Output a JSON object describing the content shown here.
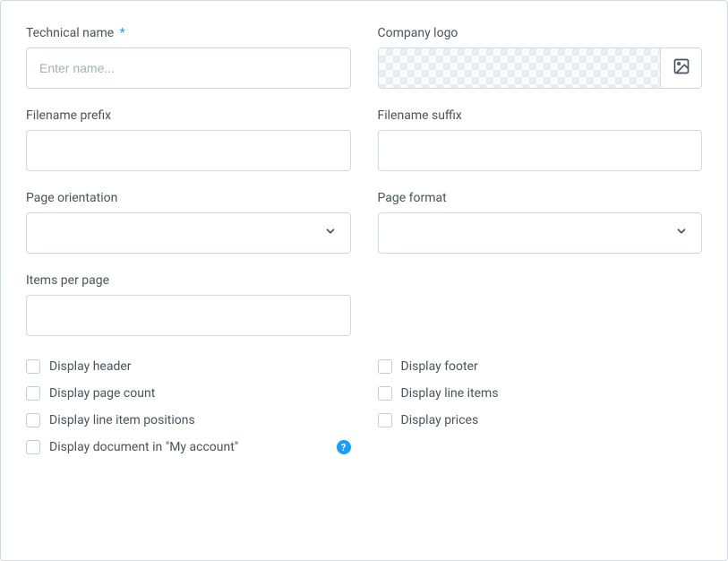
{
  "fields": {
    "technical_name": {
      "label": "Technical name",
      "required": true,
      "placeholder": "Enter name..."
    },
    "company_logo": {
      "label": "Company logo"
    },
    "filename_prefix": {
      "label": "Filename prefix"
    },
    "filename_suffix": {
      "label": "Filename suffix"
    },
    "page_orientation": {
      "label": "Page orientation"
    },
    "page_format": {
      "label": "Page format"
    },
    "items_per_page": {
      "label": "Items per page"
    }
  },
  "checkboxes": {
    "display_header": "Display header",
    "display_footer": "Display footer",
    "display_page_count": "Display page count",
    "display_line_items": "Display line items",
    "display_line_item_positions": "Display line item positions",
    "display_prices": "Display prices",
    "display_document_my_account": "Display document in \"My account\""
  },
  "required_marker": "*",
  "help_marker": "?"
}
